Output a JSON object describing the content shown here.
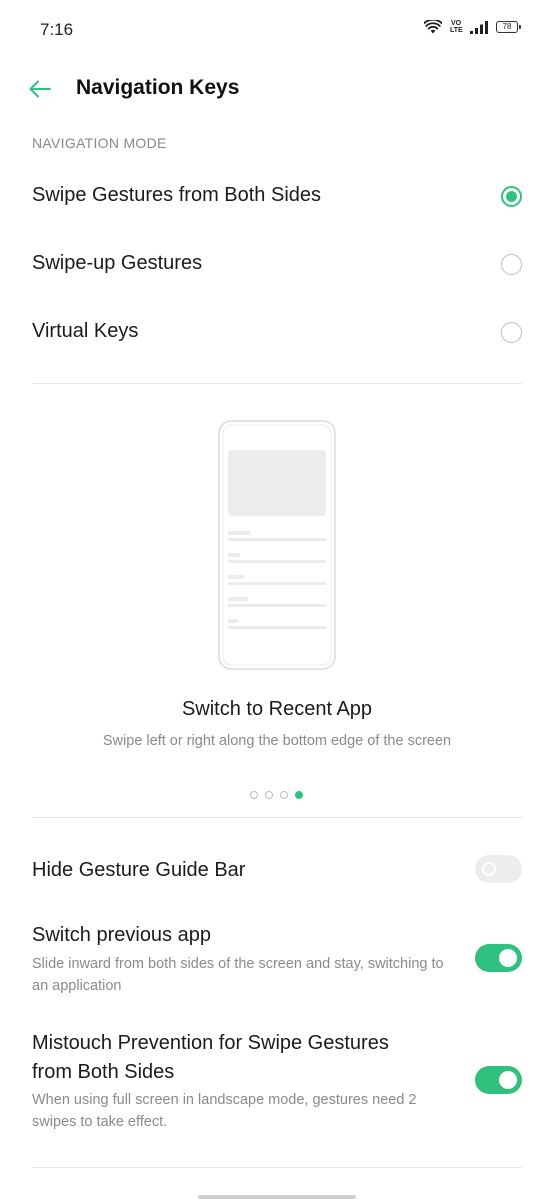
{
  "status_bar": {
    "time": "7:16",
    "volte_top": "VO",
    "volte_bottom": "LTE",
    "battery": "78"
  },
  "header": {
    "title": "Navigation Keys"
  },
  "navigation_mode": {
    "label": "NAVIGATION MODE",
    "options": [
      {
        "label": "Swipe Gestures from Both Sides",
        "selected": true
      },
      {
        "label": "Swipe-up Gestures",
        "selected": false
      },
      {
        "label": "Virtual Keys",
        "selected": false
      }
    ]
  },
  "demo": {
    "title": "Switch to Recent App",
    "description": "Swipe left or right along the bottom edge of the screen",
    "page_count": 4,
    "active_page": 4
  },
  "settings": [
    {
      "title": "Hide Gesture Guide Bar",
      "description": "",
      "enabled": false
    },
    {
      "title": "Switch previous app",
      "description": "Slide inward from both sides of the screen and stay, switching to an application",
      "enabled": true
    },
    {
      "title": "Mistouch Prevention for Swipe Gestures from Both Sides",
      "description": "When using full screen in landscape mode, gestures need 2 swipes to take effect.",
      "enabled": true
    }
  ],
  "colors": {
    "accent": "#2ec27e",
    "text_primary": "#1b1b1b",
    "text_secondary": "#8a8a8a"
  }
}
